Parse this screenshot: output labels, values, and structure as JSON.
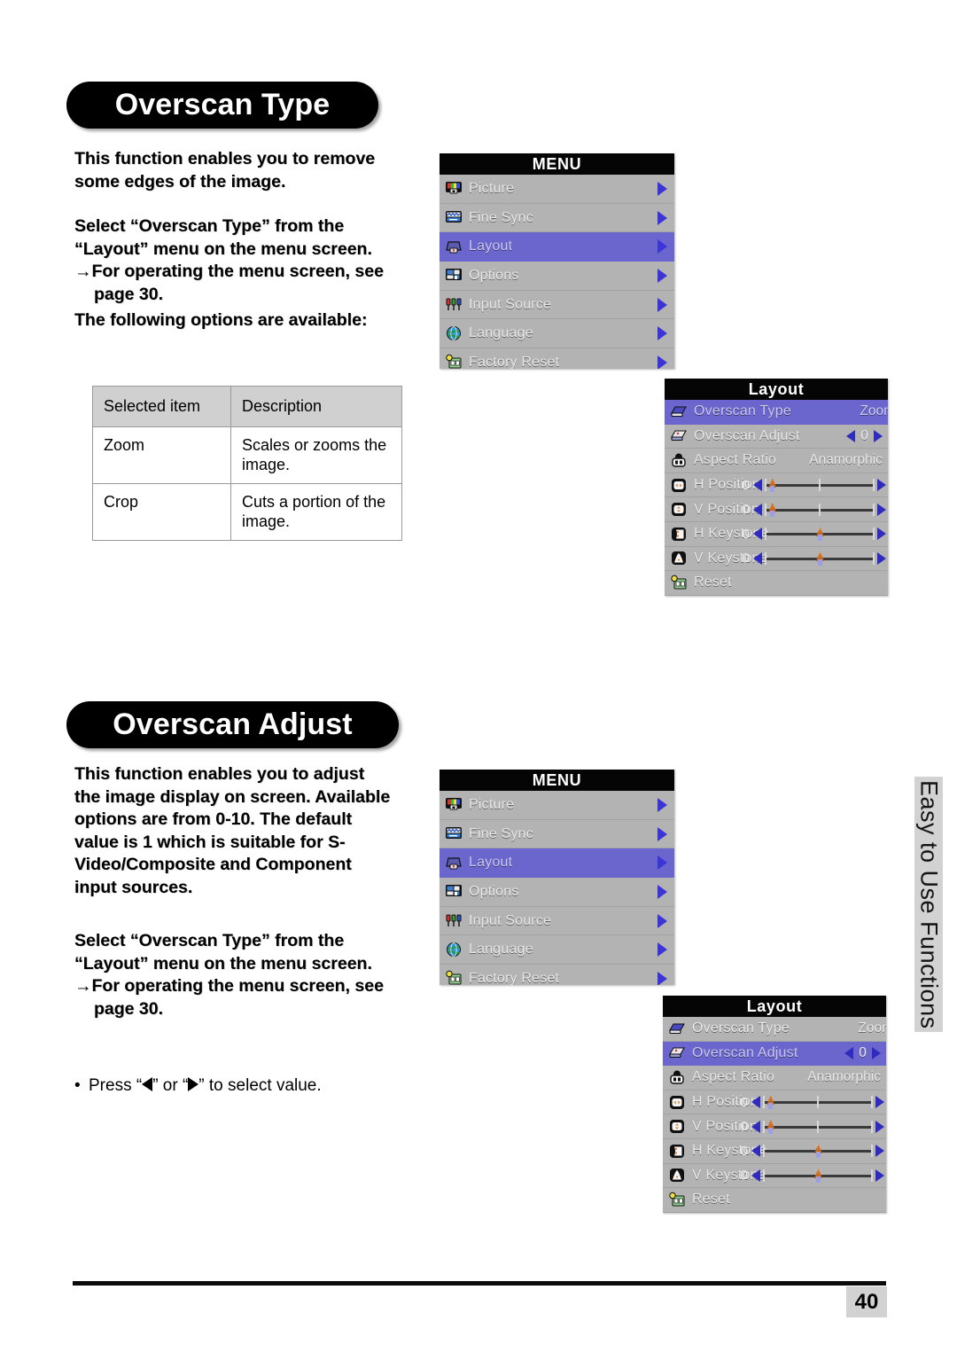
{
  "page": {
    "number": "40",
    "side_tab": "Easy to Use Functions"
  },
  "sections": [
    {
      "heading": "Overscan Type",
      "intro_lines": [
        "This function enables you to remove",
        "some edges of the image."
      ],
      "select_lines": [
        "Select “Overscan Type” from the",
        "“Layout” menu on the menu screen."
      ],
      "arrow_line_1": "→For operating the menu screen, see",
      "arrow_line_2": "page 30.",
      "options_intro": "The following options are available:"
    },
    {
      "heading": "Overscan Adjust",
      "intro_lines": [
        "This function enables you to adjust",
        "the image display on screen. Available",
        "options are from 0-10. The default",
        "value is 1 which is suitable for S-",
        "Video/Composite and Component",
        "input sources."
      ],
      "select_lines": [
        "Select “Overscan Type” from the",
        "“Layout” menu on the menu screen."
      ],
      "arrow_line_1": "→For operating the menu screen, see",
      "arrow_line_2": "page 30.",
      "press_note_pre": "Press “",
      "press_note_mid": "” or “",
      "press_note_post": "” to select value."
    }
  ],
  "options_table": {
    "headers": [
      "Selected item",
      "Description"
    ],
    "rows": [
      {
        "item": "Zoom",
        "description": "Scales or zooms the image."
      },
      {
        "item": "Crop",
        "description": "Cuts a portion of the image."
      }
    ]
  },
  "osd": {
    "main_menu": {
      "title": "MENU",
      "items": [
        {
          "label": "Picture",
          "icon": "picture-icon",
          "selected": false
        },
        {
          "label": "Fine Sync",
          "icon": "fine-sync-icon",
          "selected": false
        },
        {
          "label": "Layout",
          "icon": "layout-icon",
          "selected": true
        },
        {
          "label": "Options",
          "icon": "options-icon",
          "selected": false
        },
        {
          "label": "Input Source",
          "icon": "input-source-icon",
          "selected": false
        },
        {
          "label": "Language",
          "icon": "language-icon",
          "selected": false
        },
        {
          "label": "Factory Reset",
          "icon": "factory-reset-icon",
          "selected": false
        }
      ]
    },
    "layout_menu_a": {
      "title": "Layout",
      "selected_index": 0,
      "items": [
        {
          "label": "Overscan Type",
          "icon": "overscan-type-icon",
          "value": "Zoom",
          "control": "text"
        },
        {
          "label": "Overscan Adjust",
          "icon": "overscan-adjust-icon",
          "value": "0",
          "control": "spinner"
        },
        {
          "label": "Aspect Ratio",
          "icon": "aspect-ratio-icon",
          "value": "Anamorphic",
          "control": "text"
        },
        {
          "label": "H Position",
          "icon": "h-position-icon",
          "value": "0",
          "control": "slider",
          "knob_pct": 6
        },
        {
          "label": "V Position",
          "icon": "v-position-icon",
          "value": "0",
          "control": "slider",
          "knob_pct": 6
        },
        {
          "label": "H Keystone",
          "icon": "h-keystone-icon",
          "value": "0",
          "control": "slider",
          "knob_pct": 50
        },
        {
          "label": "V Keystone",
          "icon": "v-keystone-icon",
          "value": "0",
          "control": "slider",
          "knob_pct": 50
        },
        {
          "label": "Reset",
          "icon": "reset-icon",
          "value": "",
          "control": "none"
        }
      ]
    },
    "layout_menu_b": {
      "title": "Layout",
      "selected_index": 1,
      "items": [
        {
          "label": "Overscan Type",
          "icon": "overscan-type-icon",
          "value": "Zoom",
          "control": "text"
        },
        {
          "label": "Overscan Adjust",
          "icon": "overscan-adjust-icon",
          "value": "0",
          "control": "spinner"
        },
        {
          "label": "Aspect Ratio",
          "icon": "aspect-ratio-icon",
          "value": "Anamorphic",
          "control": "text"
        },
        {
          "label": "H Position",
          "icon": "h-position-icon",
          "value": "0",
          "control": "slider",
          "knob_pct": 6
        },
        {
          "label": "V Position",
          "icon": "v-position-icon",
          "value": "0",
          "control": "slider",
          "knob_pct": 6
        },
        {
          "label": "H Keystone",
          "icon": "h-keystone-icon",
          "value": "0",
          "control": "slider",
          "knob_pct": 50
        },
        {
          "label": "V Keystone",
          "icon": "v-keystone-icon",
          "value": "0",
          "control": "slider",
          "knob_pct": 50
        },
        {
          "label": "Reset",
          "icon": "reset-icon",
          "value": "",
          "control": "none"
        }
      ]
    }
  },
  "colors": {
    "osd_background": "#b3b3b3",
    "osd_highlight": "#6a66cd",
    "osd_title_bar": "#050505",
    "caret_blue": "#3b34d6",
    "table_header": "#d0d0d0",
    "tab_gray": "#d2d2d2"
  }
}
